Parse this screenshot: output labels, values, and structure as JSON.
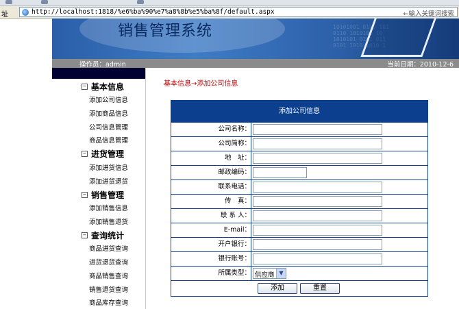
{
  "browser": {
    "address_label": "址",
    "url": "http://localhost:1818/%e6%ba%90%e7%a8%8b%e5%ba%8f/default.aspx",
    "search_hint": "←输入关键词搜索"
  },
  "header": {
    "title": "销售管理系统",
    "operator": "操作员：admin",
    "date": "当前日期：2010-12-6"
  },
  "sidebar": {
    "sections": [
      {
        "label": "基本信息",
        "items": [
          "添加公司信息",
          "添加商品信息",
          "公司信息管理",
          "商品信息管理"
        ]
      },
      {
        "label": "进货管理",
        "items": [
          "添加进货信息",
          "添加进货退货"
        ]
      },
      {
        "label": "销售管理",
        "items": [
          "添加销售信息",
          "添加销售退货"
        ]
      },
      {
        "label": "查询统计",
        "items": [
          "商品进货查询",
          "进货退货查询",
          "商品销售查询",
          "销售退货查询",
          "商品库存查询"
        ]
      }
    ]
  },
  "breadcrumb": "基本信息→添加公司信息",
  "form": {
    "title": "添加公司信息",
    "fields": [
      {
        "label": "公司名称：",
        "value": ""
      },
      {
        "label": "公司简称：",
        "value": ""
      },
      {
        "label": "地　址：",
        "value": ""
      },
      {
        "label": "邮政编码：",
        "value": ""
      },
      {
        "label": "联系电话：",
        "value": ""
      },
      {
        "label": "传　真：",
        "value": ""
      },
      {
        "label": "联 系 人：",
        "value": ""
      },
      {
        "label": "E-mail：",
        "value": ""
      },
      {
        "label": "开户银行：",
        "value": ""
      },
      {
        "label": "银行账号：",
        "value": ""
      }
    ],
    "type_label": "所属类型：",
    "type_value": "供应商",
    "add_button": "添加",
    "reset_button": "重置"
  },
  "colors": {
    "form_header": "#0d3f8f",
    "breadcrumb": "#c00000",
    "sidebar_head": "#000033",
    "info_bar": "#8b8b8b"
  }
}
